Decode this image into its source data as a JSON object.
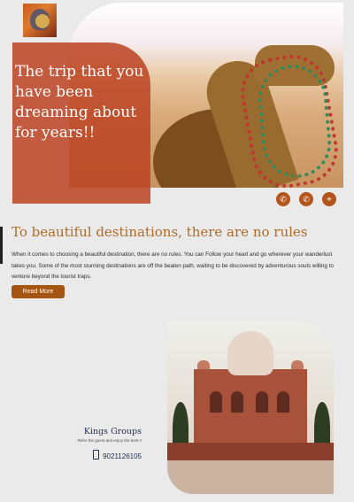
{
  "hero": {
    "title": "The trip that you have been dreaming about for years!!"
  },
  "social": [
    {
      "icon": "phone-icon",
      "glyph": "✆"
    },
    {
      "icon": "whatsapp-icon",
      "glyph": "✆"
    },
    {
      "icon": "location-pin-icon",
      "glyph": "⌖"
    }
  ],
  "intro": {
    "headline": "To beautiful destinations, there are no rules",
    "paragraph": "When it comes to choosing a beautiful destination, there are no rules. You can Follow your heart and go wherever your wanderlust takes you. Some of the most stunning destinations are off the beaten path, waiting to be discovered by adventurous souls willing to venture beyond the tourist traps.",
    "read_more_label": "Read More"
  },
  "company": {
    "name": "Kings Groups",
    "tagline": "Refer the guest and enjoy the best !!",
    "phone": "9021126105"
  },
  "colors": {
    "accent": "#b06a26",
    "button": "#a45511",
    "overlay": "#bc4423",
    "brand_text": "#1f2d4d"
  }
}
